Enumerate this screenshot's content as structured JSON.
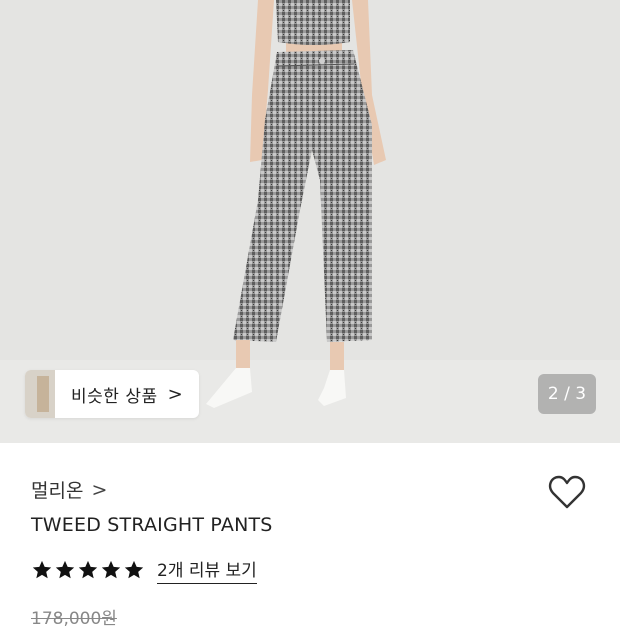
{
  "gallery": {
    "similar_label": "비슷한 상품",
    "similar_chevron": ">",
    "pager_text": "2 / 3"
  },
  "product": {
    "brand": "멀리온",
    "brand_chevron": ">",
    "title": "TWEED STRAIGHT PANTS",
    "rating": 5,
    "rating_max": 5,
    "reviews_link": "2개 리뷰 보기",
    "original_price": "178,000원"
  },
  "icons": {
    "heart": "heart-outline-icon",
    "star": "star-filled-icon",
    "chevron": "chevron-right-icon"
  },
  "colors": {
    "accent": "#222222",
    "hero_bg": "#e4e4e2",
    "price_strike": "#888888"
  }
}
